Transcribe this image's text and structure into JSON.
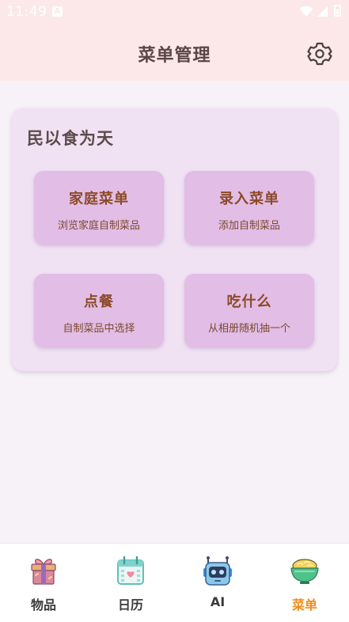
{
  "status_bar": {
    "time": "11:49",
    "notification_glyph": "A"
  },
  "header": {
    "title": "菜单管理",
    "settings_icon": "gear-icon"
  },
  "card": {
    "title": "民以食为天",
    "tiles": [
      {
        "title": "家庭菜单",
        "subtitle": "浏览家庭自制菜品"
      },
      {
        "title": "录入菜单",
        "subtitle": "添加自制菜品"
      },
      {
        "title": "点餐",
        "subtitle": "自制菜品中选择"
      },
      {
        "title": "吃什么",
        "subtitle": "从相册随机抽一个"
      }
    ]
  },
  "bottom_nav": {
    "active_index": 3,
    "items": [
      {
        "label": "物品",
        "icon": "gift-icon"
      },
      {
        "label": "日历",
        "icon": "calendar-icon"
      },
      {
        "label": "AI",
        "icon": "robot-icon"
      },
      {
        "label": "菜单",
        "icon": "rice-bowl-icon"
      }
    ]
  },
  "colors": {
    "header_bg": "#fce8e8",
    "page_bg": "#f7f2f8",
    "card_bg": "#f0e1f3",
    "tile_bg": "#e2bde6",
    "tile_title": "#8b4a27",
    "active_nav": "#f28c1c"
  }
}
